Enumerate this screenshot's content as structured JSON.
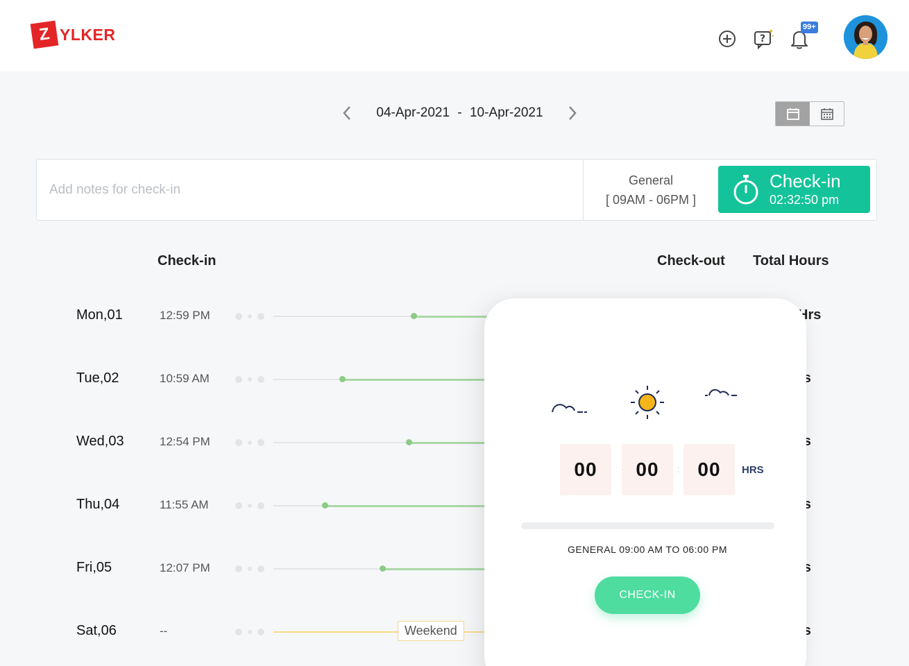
{
  "header": {
    "logo_letter": "Z",
    "logo_text": "YLKER",
    "notification_count": "99+",
    "icons": [
      "add-icon",
      "help-chat-icon",
      "bell-icon"
    ]
  },
  "date_nav": {
    "start": "04-Apr-2021",
    "separator": "-",
    "end": "10-Apr-2021"
  },
  "view_toggle": {
    "active": "day-view",
    "options": [
      "day-view-icon",
      "calendar-view-icon"
    ]
  },
  "checkin_bar": {
    "notes_placeholder": "Add notes for check-in",
    "shift_name": "General",
    "shift_hours": "[ 09AM - 06PM ]",
    "button_label": "Check-in",
    "button_time": "02:32:50 pm",
    "accent": "#14c39a"
  },
  "columns": {
    "checkin": "Check-in",
    "checkout": "Check-out",
    "total": "Total Hours"
  },
  "rows": [
    {
      "day": "Mon,01",
      "checkin": "12:59 PM",
      "hrs": "Hrs",
      "progress_start": 0.63
    },
    {
      "day": "Tue,02",
      "checkin": "10:59 AM",
      "hrs": "rs",
      "progress_start": 0.31
    },
    {
      "day": "Wed,03",
      "checkin": "12:54 PM",
      "hrs": "rs",
      "progress_start": 0.61
    },
    {
      "day": "Thu,04",
      "checkin": "11:55 AM",
      "hrs": "rs",
      "progress_start": 0.23
    },
    {
      "day": "Fri,05",
      "checkin": "12:07 PM",
      "hrs": "rs",
      "progress_start": 0.49
    },
    {
      "day": "Sat,06",
      "checkin": "--",
      "hrs": "rs",
      "tag": "Weekend"
    }
  ],
  "phone": {
    "hours": "00",
    "minutes": "00",
    "seconds": "00",
    "unit": "HRS",
    "shift_text": "GENERAL 09:00  AM TO 06:00  PM",
    "button_label": "CHECK-IN",
    "accent": "#4edc9f"
  }
}
